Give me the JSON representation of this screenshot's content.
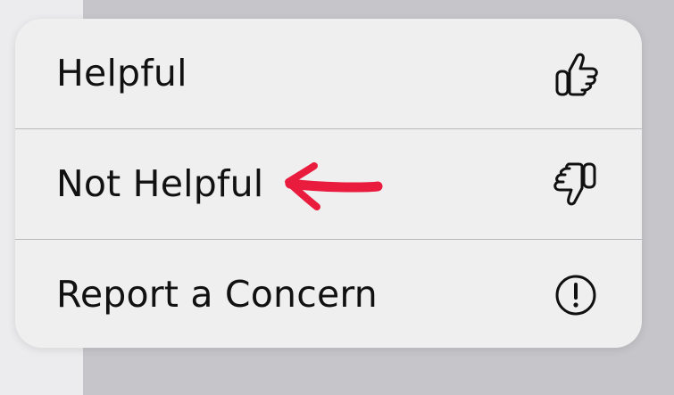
{
  "menu": {
    "items": [
      {
        "label": "Helpful",
        "icon": "thumbs-up-icon"
      },
      {
        "label": "Not Helpful",
        "icon": "thumbs-down-icon"
      },
      {
        "label": "Report a Concern",
        "icon": "exclamation-circle-icon"
      }
    ]
  },
  "annotation": {
    "icon": "red-arrow-icon",
    "color": "#ea1c3e"
  },
  "colors": {
    "menu_background": "#efeff0",
    "divider": "#b9b9bd",
    "text": "#111111"
  }
}
